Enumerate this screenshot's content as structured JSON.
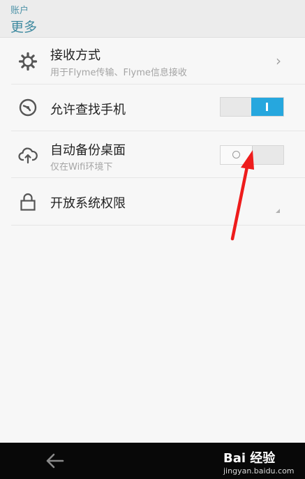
{
  "header": {
    "breadcrumb": "账户",
    "title": "更多"
  },
  "settings": [
    {
      "title": "接收方式",
      "subtitle": "用于Flyme传输、Flyme信息接收",
      "icon": "gear-icon",
      "control": "chevron"
    },
    {
      "title": "允许查找手机",
      "subtitle": "",
      "icon": "find-phone-icon",
      "control": "toggle",
      "state": "on"
    },
    {
      "title": "自动备份桌面",
      "subtitle": "仅在Wifi环境下",
      "icon": "cloud-upload-icon",
      "control": "toggle",
      "state": "off"
    },
    {
      "title": "开放系统权限",
      "subtitle": "",
      "icon": "lock-icon",
      "control": "corner"
    }
  ],
  "colors": {
    "accent": "#26a7de",
    "header_text": "#3f8aa0",
    "annotation_arrow": "#ee1c1c"
  },
  "watermark": {
    "logo": "Bai 经验",
    "url": "jingyan.baidu.com"
  }
}
